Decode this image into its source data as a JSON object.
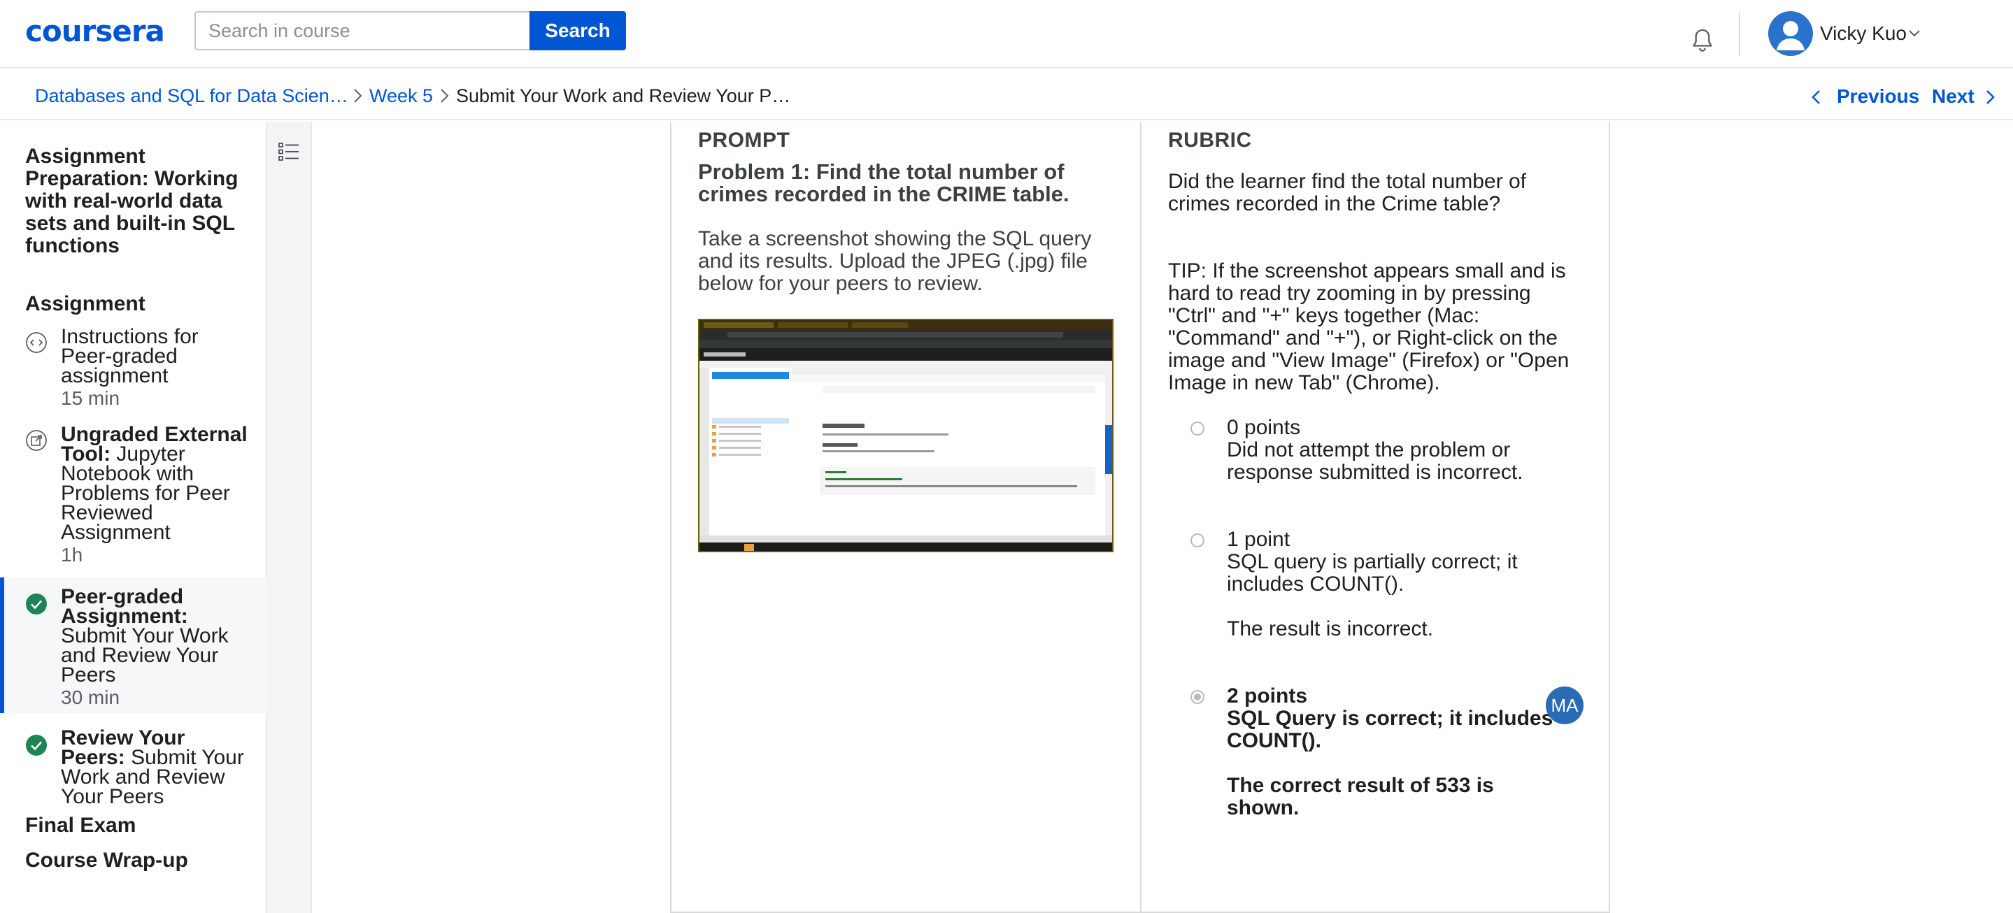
{
  "header": {
    "logo_text": "coursera",
    "search": {
      "placeholder": "Search in course",
      "button_label": "Search"
    },
    "user": {
      "name": "Vicky Kuo"
    }
  },
  "breadcrumb": {
    "items": [
      "Databases and SQL for Data Scien…",
      "Week 5",
      "Submit Your Work and Review Your P…"
    ],
    "previous_label": "Previous",
    "next_label": "Next"
  },
  "sidebar": {
    "module_title": "Assignment Preparation: Working with real-world data sets and built-in SQL functions",
    "section_assignment": "Assignment",
    "items": [
      {
        "label": "Instructions for Peer-graded assignment",
        "duration": "15 min",
        "icon": "reading-icon",
        "state": "normal"
      },
      {
        "type_label": "Ungraded External Tool:",
        "label": "Jupyter Notebook with Problems for Peer Reviewed Assignment",
        "duration": "1h",
        "icon": "external-tool-icon",
        "state": "normal"
      },
      {
        "type_label": "Peer-graded Assignment:",
        "label": "Submit Your Work and Review Your Peers",
        "duration": "30 min",
        "icon": "completed-check-icon",
        "state": "active"
      },
      {
        "type_label": "Review Your Peers:",
        "label": "Submit Your Work and Review Your Peers",
        "duration": "",
        "icon": "completed-check-icon",
        "state": "normal"
      }
    ],
    "section_final_exam": "Final Exam",
    "section_wrap_up": "Course Wrap-up"
  },
  "prompt": {
    "heading": "PROMPT",
    "title": "Problem 1: Find the total number of crimes recorded in the CRIME table.",
    "body": "Take a screenshot showing the SQL query and its results. Upload the JPEG (.jpg) file below for your peers to review."
  },
  "rubric": {
    "heading": "RUBRIC",
    "question": "Did the learner find the total number of crimes recorded in the Crime table?",
    "tip": "TIP: If the screenshot appears small and is hard to read try zooming in by pressing \"Ctrl\" and \"+\" keys together (Mac: \"Command\" and \"+\"), or Right-click on the image and \"View Image\" (Firefox) or \"Open Image in new Tab\" (Chrome).",
    "options": [
      {
        "points": "0 points",
        "lines": [
          "Did not attempt the problem or response submitted is incorrect."
        ],
        "selected": false
      },
      {
        "points": "1 point",
        "lines": [
          "SQL query is partially correct; it includes COUNT().",
          "The result is incorrect."
        ],
        "selected": false
      },
      {
        "points": "2 points",
        "lines": [
          "SQL Query is correct; it includes COUNT().",
          "The correct result of 533 is shown."
        ],
        "selected": true
      }
    ],
    "grader_initials": "MA"
  },
  "colors": {
    "brand": "#0056d2",
    "success": "#1f8354",
    "active_bg": "#f5f7f8"
  }
}
